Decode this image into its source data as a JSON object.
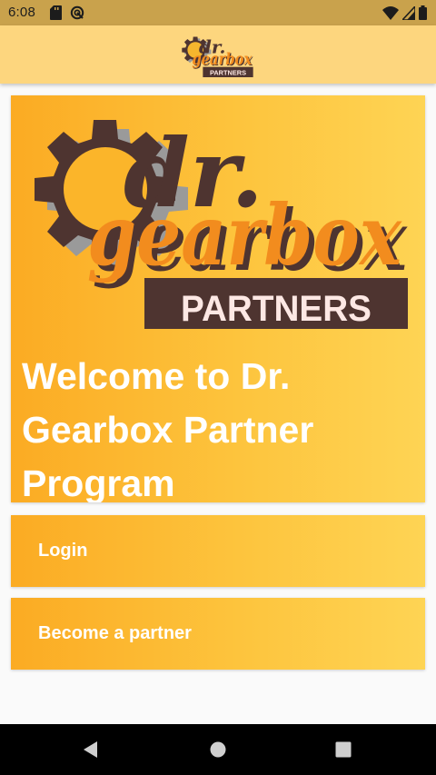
{
  "status_bar": {
    "time": "6:08",
    "icons": [
      "sd-card-icon",
      "sync-icon",
      "wifi-icon",
      "cellular-signal-icon",
      "battery-icon"
    ]
  },
  "app_bar": {
    "logo": {
      "word_top": "dr.",
      "word_main": "gearbox",
      "badge": "PARTNERS"
    }
  },
  "hero": {
    "logo": {
      "word_top": "dr.",
      "word_main": "gearbox",
      "badge": "PARTNERS"
    },
    "title": "Welcome to Dr. Gearbox Partner Program"
  },
  "actions": {
    "login_label": "Login",
    "partner_label": "Become a partner"
  },
  "nav_bar": {
    "icons": [
      "back-icon",
      "home-icon",
      "recents-icon"
    ]
  },
  "colors": {
    "status_bar": "#c9a24c",
    "app_bar": "#fdd67e",
    "card_gradient_start": "#fbab23",
    "card_gradient_end": "#fed454",
    "logo_orange": "#f28c1e",
    "logo_brown": "#4e3430",
    "gear_gray": "#9a9a9a",
    "badge_text": "#fde8e4"
  }
}
